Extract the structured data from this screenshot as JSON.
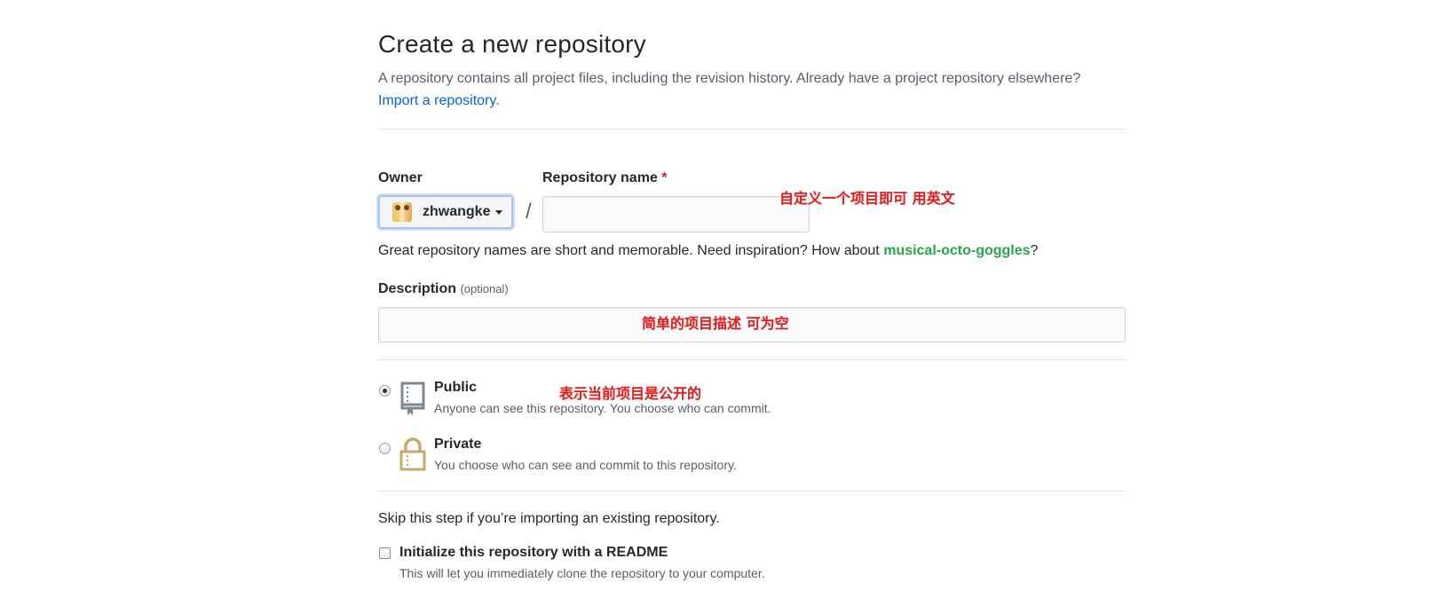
{
  "header": {
    "title": "Create a new repository",
    "subtitle": "A repository contains all project files, including the revision history. Already have a project repository elsewhere?",
    "import_link": "Import a repository."
  },
  "owner": {
    "label": "Owner",
    "name": "zhwangke"
  },
  "repo_name": {
    "label": "Repository name",
    "required_marker": "*",
    "value": "",
    "placeholder": ""
  },
  "separator": "/",
  "hint": {
    "prefix": "Great repository names are short and memorable. Need inspiration? How about ",
    "suggestion": "musical-octo-goggles",
    "suffix": "?"
  },
  "description": {
    "label": "Description",
    "optional": "(optional)",
    "value": "",
    "placeholder": ""
  },
  "visibility": {
    "selected": "public",
    "public": {
      "title": "Public",
      "desc": "Anyone can see this repository. You choose who can commit."
    },
    "private": {
      "title": "Private",
      "desc": "You choose who can see and commit to this repository."
    }
  },
  "init": {
    "skip_text": "Skip this step if you’re importing an existing repository.",
    "readme_label": "Initialize this repository with a README",
    "readme_desc": "This will let you immediately clone the repository to your computer.",
    "readme_checked": false
  },
  "annotations": {
    "repo_name_note": "自定义一个项目即可 用英文",
    "description_note": "简单的项目描述 可为空",
    "public_note": "表示当前项目是公开的"
  },
  "colors": {
    "link": "#0366d6",
    "suggestion": "#28a745",
    "required": "#cb2431",
    "annotation": "#e02020",
    "muted": "#586069"
  },
  "icons": {
    "owner_caret": "chevron-down-icon",
    "public": "repo-book-icon",
    "private": "lock-icon"
  }
}
